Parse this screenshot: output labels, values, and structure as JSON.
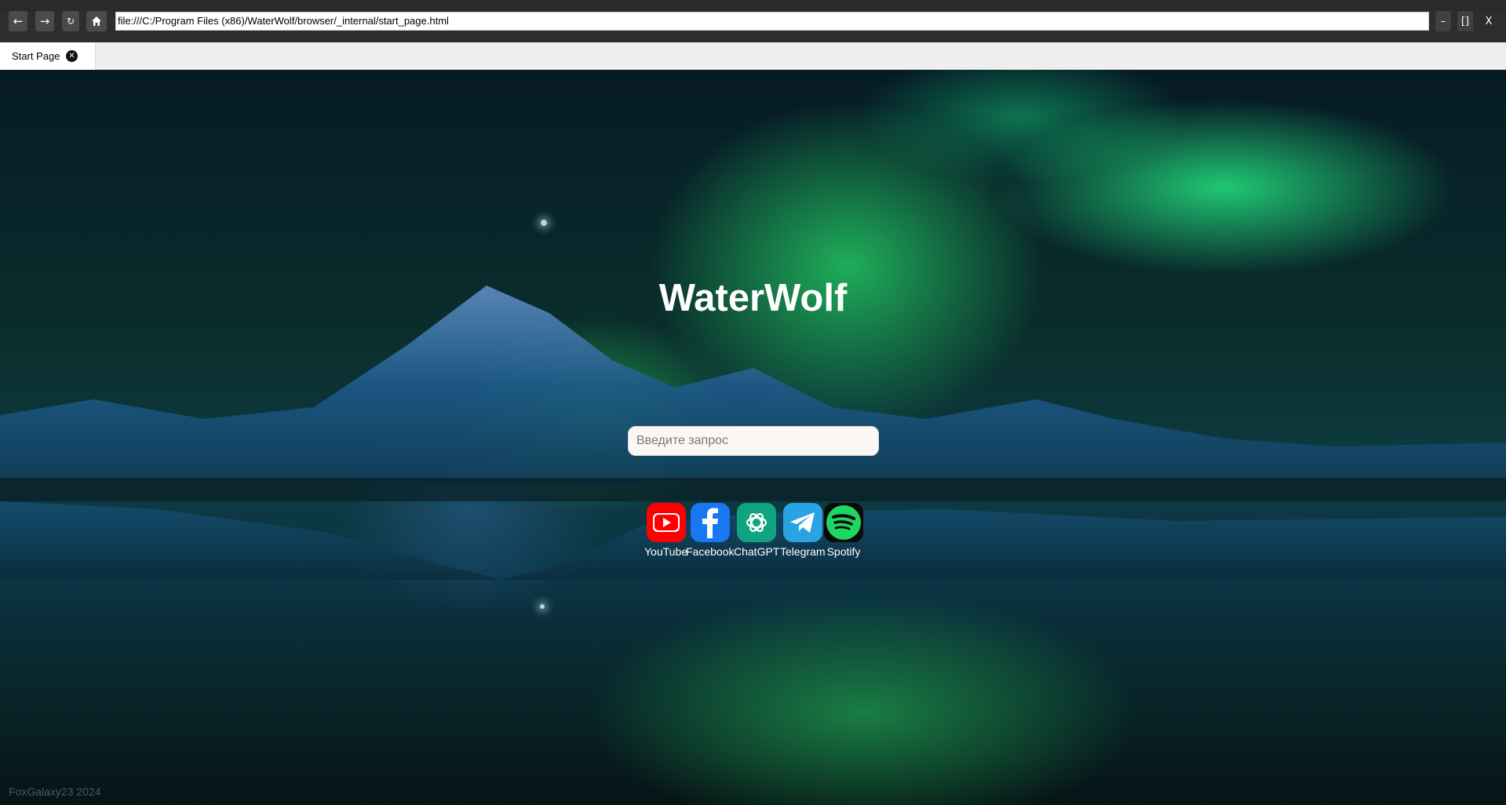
{
  "toolbar": {
    "back_icon": "←",
    "forward_icon": "→",
    "reload_icon": "↻",
    "address_url": "file:///C:/Program Files (x86)/WaterWolf/browser/_internal/start_page.html"
  },
  "window_controls": {
    "minimize_label": "–",
    "maximize_label": "[]",
    "close_label": "X"
  },
  "tabs": [
    {
      "label": "Start Page",
      "close_icon": "✕"
    }
  ],
  "page": {
    "brand_title": "WaterWolf",
    "search_placeholder": "Введите запрос",
    "footer_text": "FoxGalaxy23 2024",
    "quick_links": [
      {
        "label": "YouTube",
        "icon": "youtube-icon",
        "color": "#ff0000"
      },
      {
        "label": "Facebook",
        "icon": "facebook-icon",
        "color": "#1877f2"
      },
      {
        "label": "ChatGPT",
        "icon": "chatgpt-icon",
        "color": "#10a37f"
      },
      {
        "label": "Telegram",
        "icon": "telegram-icon",
        "color": "#2aa3e2"
      },
      {
        "label": "Spotify",
        "icon": "spotify-icon",
        "color": "#1ed760"
      }
    ]
  }
}
